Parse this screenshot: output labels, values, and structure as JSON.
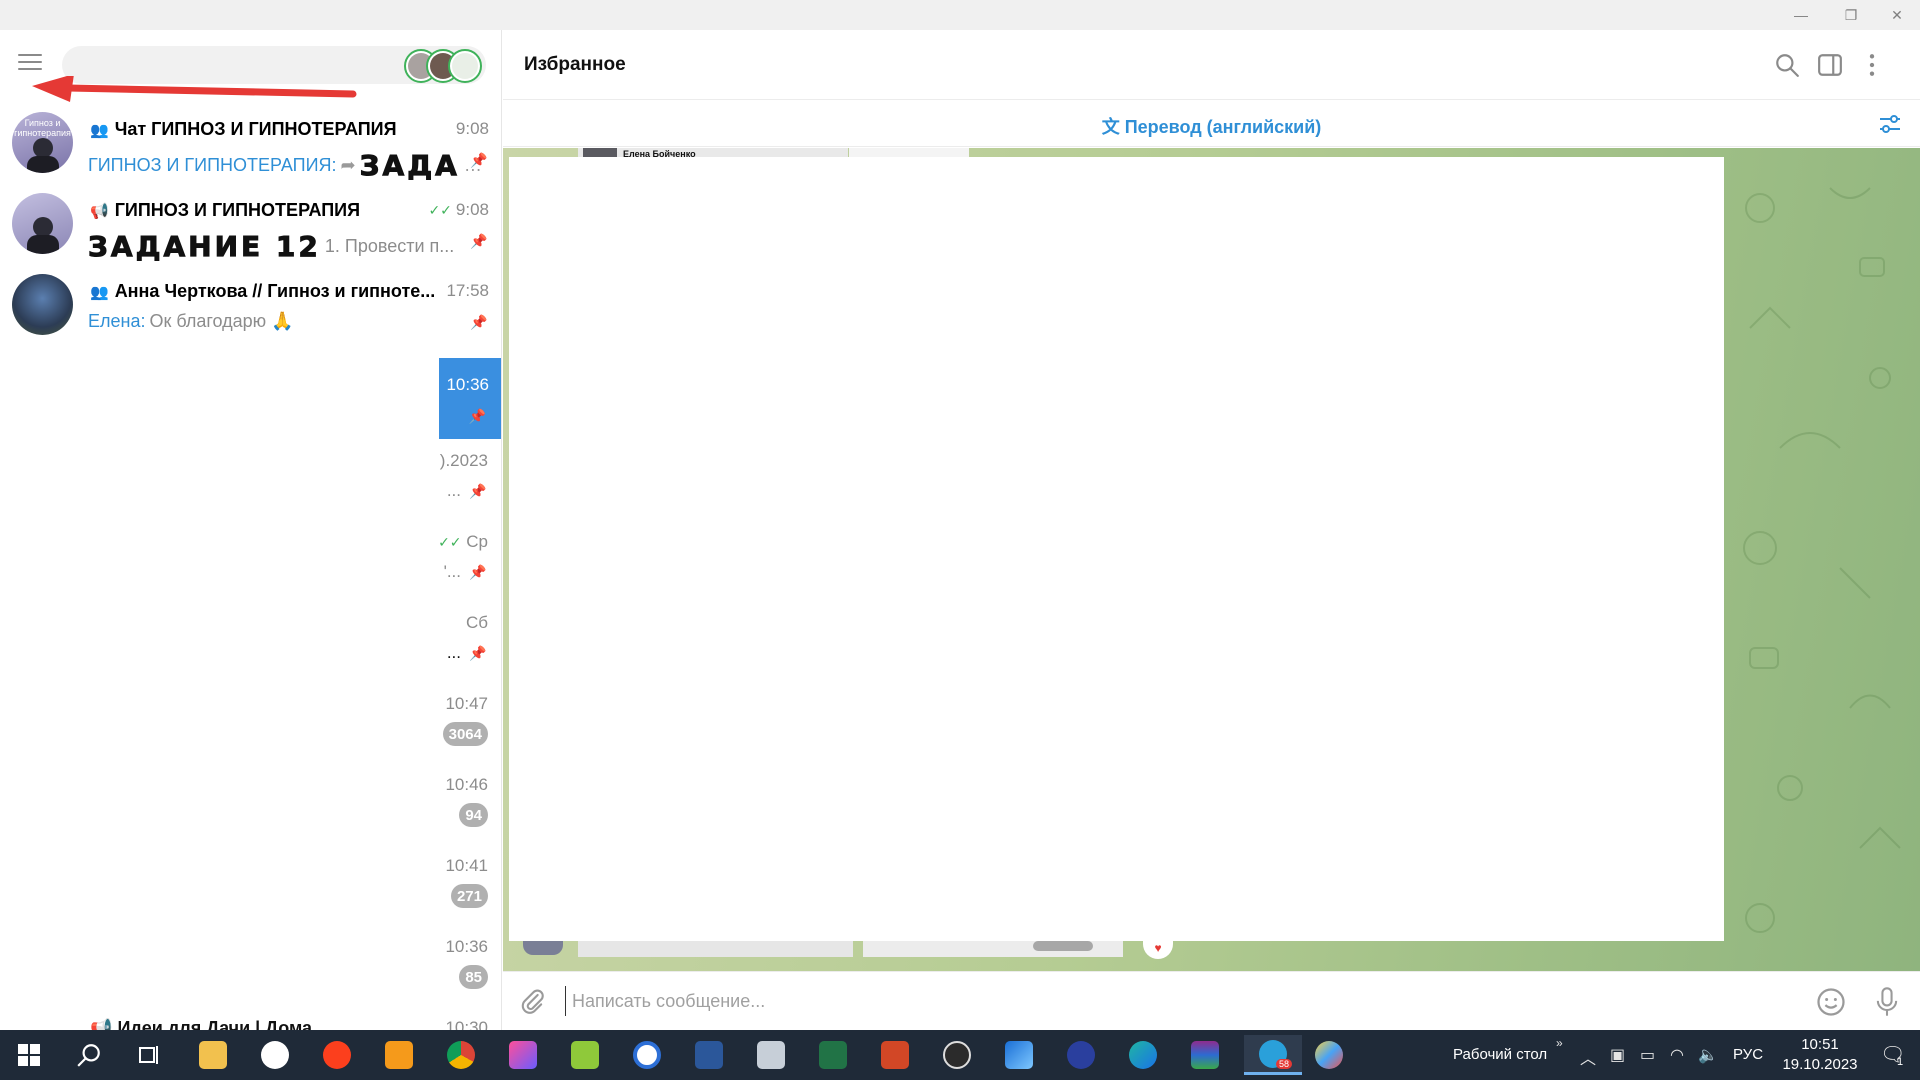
{
  "window": {
    "minimize": "—",
    "restore": "❐",
    "close": "✕"
  },
  "sidebar": {
    "chats": [
      {
        "title": "Чат ГИПНОЗ И ГИПНОТЕРАПИЯ",
        "time": "9:08",
        "preview_sender": "ГИПНОЗ И ГИПНОТЕРАПИЯ:",
        "preview_text": "ЗАДА",
        "type": "group",
        "avatar_text": "Гипноз и гипнотерапия"
      },
      {
        "title": "ГИПНОЗ И ГИПНОТЕРАПИЯ",
        "time": "9:08",
        "preview_big": "ЗАДАНИЕ 12",
        "preview_text": "1. Провести п...",
        "type": "channel",
        "read": "✓✓"
      },
      {
        "title": "Анна Черткова // Гипноз и гипноте...",
        "time": "17:58",
        "preview_sender": "Елена:",
        "preview_text": "Ок благодарю 🙏",
        "type": "group"
      }
    ],
    "partial_rows": [
      {
        "time": "10:36",
        "preview": ""
      },
      {
        "time": ").2023",
        "preview": "..."
      },
      {
        "time": "Ср",
        "preview": "'..."
      },
      {
        "time": "Сб",
        "preview": "..."
      },
      {
        "time": "10:47",
        "badge": "3064"
      },
      {
        "time": "10:46",
        "badge": "94"
      },
      {
        "time": "10:41",
        "badge": "271"
      },
      {
        "time": "10:36",
        "badge": "85"
      },
      {
        "time": "10:30",
        "title_partial": "Идеи для Дачи | Дома"
      }
    ]
  },
  "main": {
    "title": "Избранное",
    "translate_label": "Перевод (английский)",
    "strip_name": "Елена Бойченко",
    "composer_placeholder": "Написать сообщение..."
  },
  "taskbar": {
    "desktop_label": "Рабочий стол",
    "lang": "РУС",
    "time": "10:51",
    "date": "19.10.2023",
    "notification_count": "1",
    "telegram_badge": "58"
  },
  "colors": {
    "accent": "#2f8fd6",
    "selected": "#3a8fe0",
    "badge": "#b0b0b0",
    "chat_bg": "#b5cc93",
    "taskbar": "#1f2a38",
    "arrow": "#e53935"
  }
}
